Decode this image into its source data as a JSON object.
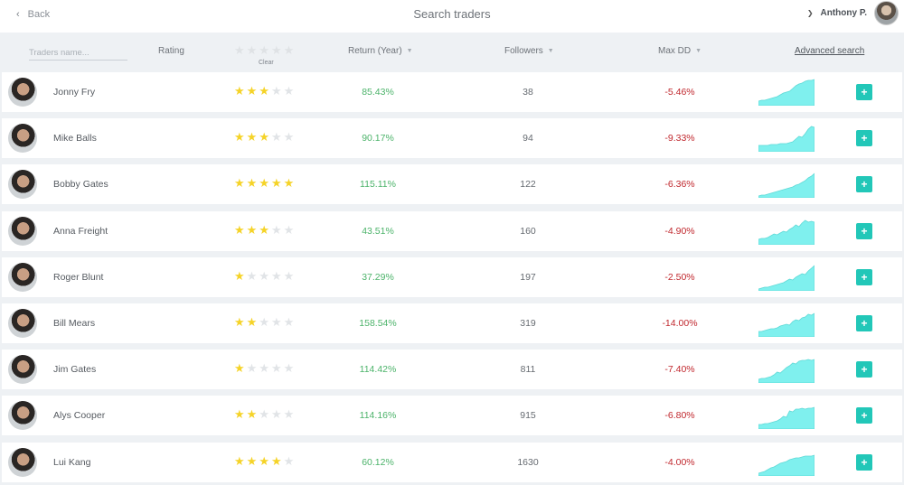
{
  "header": {
    "back_label": "Back",
    "title": "Search traders",
    "user_name": "Anthony P."
  },
  "filters": {
    "search_placeholder": "Traders name...",
    "rating_label": "Rating",
    "clear_label": "Clear",
    "return_label": "Return (Year)",
    "followers_label": "Followers",
    "maxdd_label": "Max DD",
    "advanced_label": "Advanced search"
  },
  "colors": {
    "star_on": "#f5d328",
    "return_positive": "#4cb36a",
    "drawdown": "#c0272d",
    "accent": "#22c7b8",
    "sparkline_fill": "#7ff0ee"
  },
  "traders": [
    {
      "name": "Jonny Fry",
      "rating": 3,
      "return": "85.43%",
      "followers": "38",
      "max_dd": "-5.46%",
      "spark": [
        5,
        6,
        6,
        7,
        8,
        9,
        10,
        12,
        14,
        15,
        16,
        19,
        22,
        24,
        25,
        27,
        28,
        28,
        29
      ]
    },
    {
      "name": "Mike Balls",
      "rating": 3,
      "return": "90.17%",
      "followers": "94",
      "max_dd": "-9.33%",
      "spark": [
        7,
        7,
        7,
        7,
        8,
        8,
        8,
        9,
        9,
        9,
        10,
        11,
        14,
        17,
        16,
        20,
        25,
        28,
        27
      ]
    },
    {
      "name": "Bobby Gates",
      "rating": 5,
      "return": "115.11%",
      "followers": "122",
      "max_dd": "-6.36%",
      "spark": [
        2,
        3,
        3,
        4,
        5,
        6,
        7,
        8,
        9,
        10,
        11,
        12,
        14,
        15,
        17,
        19,
        22,
        24,
        27
      ]
    },
    {
      "name": "Anna Freight",
      "rating": 3,
      "return": "43.51%",
      "followers": "160",
      "max_dd": "-4.90%",
      "spark": [
        6,
        7,
        7,
        8,
        10,
        12,
        11,
        13,
        15,
        14,
        17,
        19,
        22,
        20,
        24,
        27,
        25,
        26,
        25
      ]
    },
    {
      "name": "Roger Blunt",
      "rating": 1,
      "return": "37.29%",
      "followers": "197",
      "max_dd": "-2.50%",
      "spark": [
        2,
        3,
        4,
        4,
        5,
        6,
        7,
        8,
        9,
        11,
        13,
        12,
        15,
        17,
        19,
        18,
        22,
        25,
        28
      ]
    },
    {
      "name": "Bill Mears",
      "rating": 2,
      "return": "158.54%",
      "followers": "319",
      "max_dd": "-14.00%",
      "spark": [
        6,
        6,
        7,
        8,
        9,
        9,
        10,
        12,
        13,
        14,
        13,
        17,
        19,
        18,
        21,
        22,
        25,
        24,
        26
      ]
    },
    {
      "name": "Jim Gates",
      "rating": 1,
      "return": "114.42%",
      "followers": "811",
      "max_dd": "-7.40%",
      "spark": [
        4,
        5,
        5,
        6,
        7,
        9,
        12,
        11,
        14,
        17,
        19,
        22,
        21,
        24,
        25,
        25,
        26,
        25,
        26
      ]
    },
    {
      "name": "Alys Cooper",
      "rating": 2,
      "return": "114.16%",
      "followers": "915",
      "max_dd": "-6.80%",
      "spark": [
        5,
        5,
        6,
        6,
        7,
        8,
        9,
        11,
        14,
        13,
        20,
        19,
        22,
        22,
        23,
        22,
        23,
        23,
        24
      ]
    },
    {
      "name": "Lui Kang",
      "rating": 4,
      "return": "60.12%",
      "followers": "1630",
      "max_dd": "-4.00%",
      "spark": [
        3,
        4,
        5,
        7,
        9,
        10,
        12,
        14,
        15,
        16,
        18,
        19,
        20,
        20,
        21,
        22,
        22,
        22,
        23
      ]
    }
  ]
}
